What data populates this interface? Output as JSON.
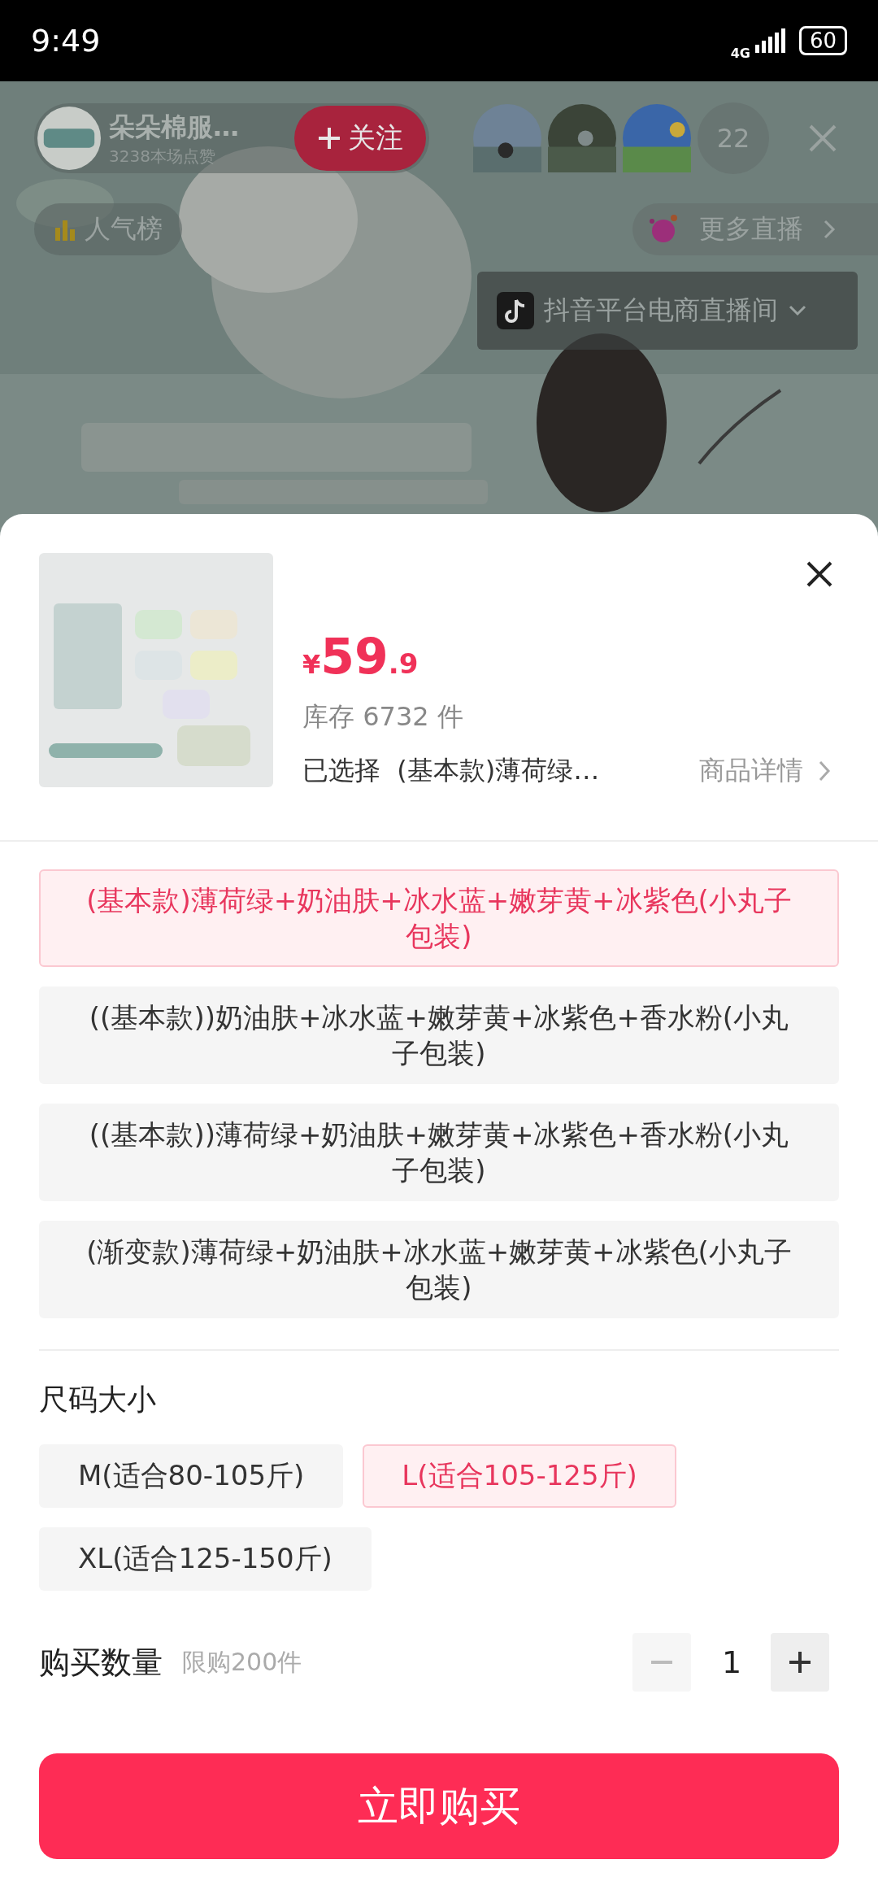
{
  "status_bar": {
    "time": "9:49",
    "network": "4G",
    "battery": "60"
  },
  "live": {
    "streamer_name": "朵朵棉服…",
    "likes": "3238本场点赞",
    "follow_label": "关注",
    "viewer_count": "22",
    "ranking_label": "人气榜",
    "more_live_label": "更多直播",
    "channel_label": "抖音平台电商直播间"
  },
  "sheet": {
    "price_currency": "¥",
    "price_integer": "59",
    "price_decimal": ".9",
    "stock": "库存 6732 件",
    "selected_label": "已选择",
    "selected_value": "(基本款)薄荷绿…",
    "details_link": "商品详情",
    "options": [
      {
        "label": "(基本款)薄荷绿+奶油肤+冰水蓝+嫩芽黄+冰紫色(小丸子包装)",
        "selected": true
      },
      {
        "label": "((基本款))奶油肤+冰水蓝+嫩芽黄+冰紫色+香水粉(小丸子包装)",
        "selected": false
      },
      {
        "label": "((基本款))薄荷绿+奶油肤+嫩芽黄+冰紫色+香水粉(小丸子包装)",
        "selected": false
      },
      {
        "label": "(渐变款)薄荷绿+奶油肤+冰水蓝+嫩芽黄+冰紫色(小丸子包装)",
        "selected": false
      }
    ],
    "size_title": "尺码大小",
    "sizes": [
      {
        "label": "M(适合80-105斤)",
        "selected": false
      },
      {
        "label": "L(适合105-125斤)",
        "selected": true
      },
      {
        "label": "XL(适合125-150斤)",
        "selected": false
      }
    ],
    "quantity_label": "购买数量",
    "quantity_limit": "限购200件",
    "quantity": "1",
    "minus_disabled": true,
    "plus_disabled": false,
    "buy_label": "立即购买"
  }
}
